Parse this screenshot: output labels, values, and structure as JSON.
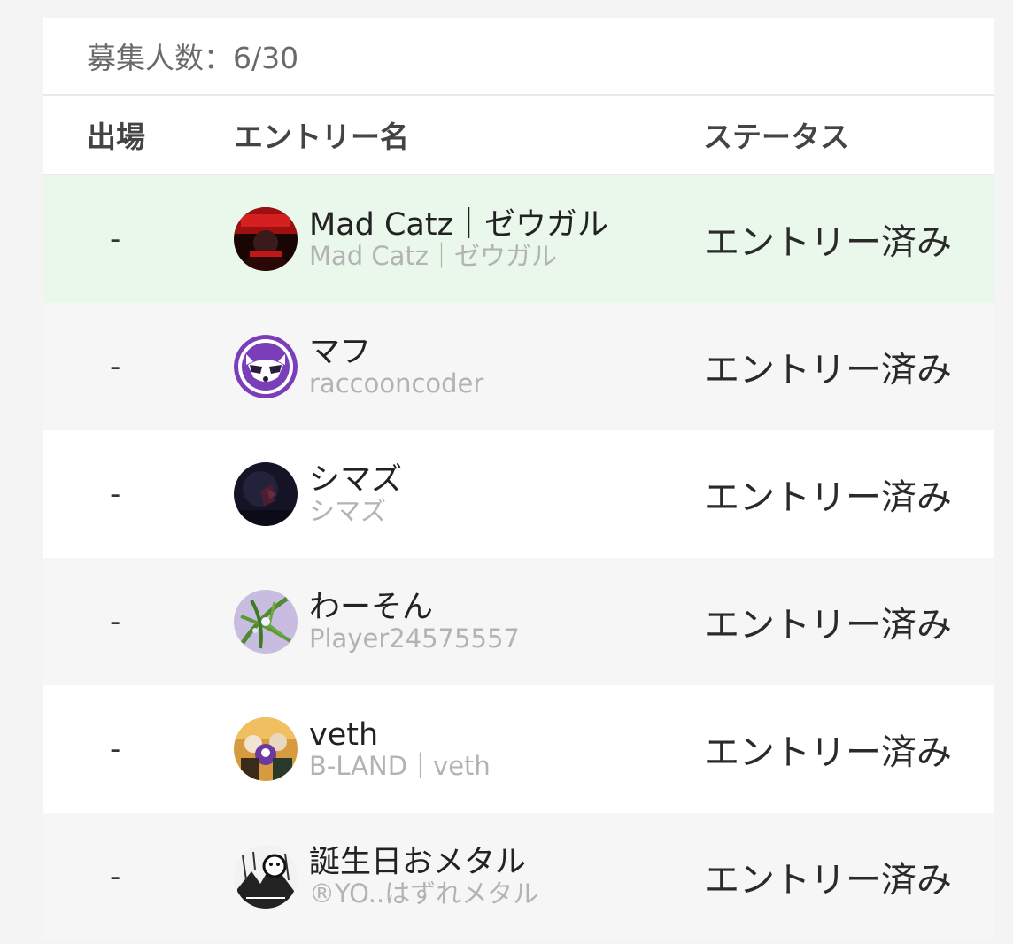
{
  "recruit_count": "募集人数：6/30",
  "columns": {
    "appear": "出場",
    "entry_name": "エントリー名",
    "status": "ステータス"
  },
  "rows": [
    {
      "appear": "-",
      "name": "Mad Catz｜ゼウガル",
      "sub": "Mad Catz｜ゼウガル",
      "status": "エントリー済み",
      "avatar": "red-dark-portrait"
    },
    {
      "appear": "-",
      "name": "マフ",
      "sub": "raccooncoder",
      "status": "エントリー済み",
      "avatar": "raccoon-icon"
    },
    {
      "appear": "-",
      "name": "シマズ",
      "sub": "シマズ",
      "status": "エントリー済み",
      "avatar": "dark-navy-portrait"
    },
    {
      "appear": "-",
      "name": "わーそん",
      "sub": "Player24575557",
      "status": "エントリー済み",
      "avatar": "purple-green-leaves"
    },
    {
      "appear": "-",
      "name": "veth",
      "sub": "B-LAND｜veth",
      "status": "エントリー済み",
      "avatar": "anime-group-portrait"
    },
    {
      "appear": "-",
      "name": "誕生日おメタル",
      "sub": "®YO..はずれメタル",
      "status": "エントリー済み",
      "avatar": "manga-bw-portrait"
    }
  ]
}
